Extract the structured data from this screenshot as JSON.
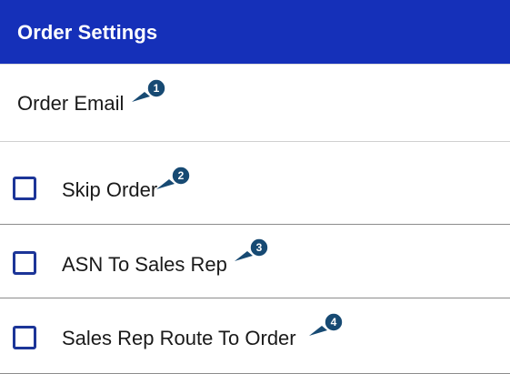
{
  "header": {
    "title": "Order Settings",
    "background_color": "#1530b9"
  },
  "settings": [
    {
      "label": "Order Email",
      "has_checkbox": false,
      "marker": "1"
    },
    {
      "label": "Skip Order",
      "has_checkbox": true,
      "checked": false,
      "marker": "2"
    },
    {
      "label": "ASN To Sales Rep",
      "has_checkbox": true,
      "checked": false,
      "marker": "3"
    },
    {
      "label": "Sales Rep Route To Order",
      "has_checkbox": true,
      "checked": false,
      "marker": "4"
    }
  ],
  "colors": {
    "checkbox_border": "#1c3598",
    "marker_fill": "#174a73"
  },
  "icons": {
    "marker": "numbered-callout-icon",
    "checkbox": "unchecked-checkbox-icon"
  }
}
